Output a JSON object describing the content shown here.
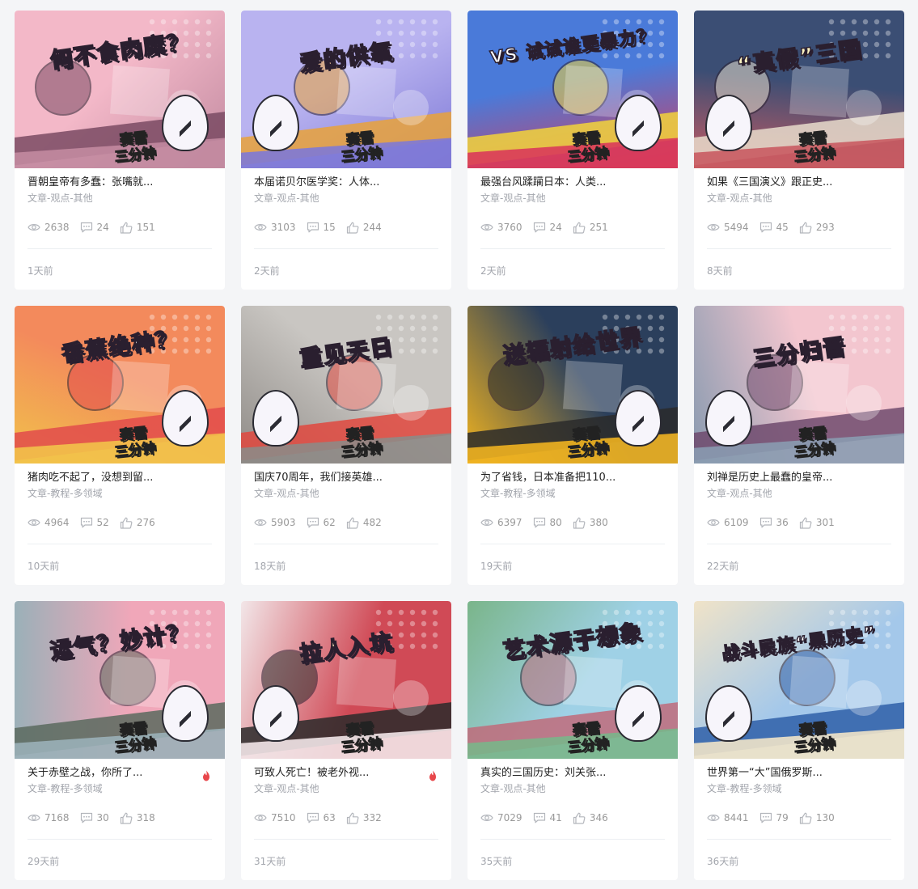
{
  "articles": [
    {
      "thumb_headline": "何不食肉糜？",
      "thumb_stamp": "赛雷\n三分钟",
      "title": "晋朝皇帝有多蠢：张嘴就...",
      "tags": "文章-观点-其他",
      "views": "2638",
      "comments": "24",
      "likes": "151",
      "time": "1天前",
      "hot": false,
      "colors": [
        "#f3b8c8",
        "#c28aa0",
        "#7a4a63"
      ]
    },
    {
      "thumb_headline": "爱的供氧",
      "thumb_stamp": "赛雷\n三分钟",
      "title": "本届诺贝尔医学奖：人体...",
      "tags": "文章-观点-其他",
      "views": "3103",
      "comments": "15",
      "likes": "244",
      "time": "2天前",
      "hot": false,
      "colors": [
        "#b9b3f0",
        "#7e79d6",
        "#e9a23a"
      ]
    },
    {
      "thumb_headline": "VS 试试谁更暴力？",
      "thumb_stamp": "赛雷\n三分钟",
      "title": "最强台风蹂躏日本：人类...",
      "tags": "文章-观点-其他",
      "views": "3760",
      "comments": "24",
      "likes": "251",
      "time": "2天前",
      "hot": false,
      "colors": [
        "#4a7ad9",
        "#d93a5a",
        "#f2d43b"
      ]
    },
    {
      "thumb_headline": "“真假”三国",
      "thumb_stamp": "赛雷\n三分钟",
      "title": "如果《三国演义》跟正史...",
      "tags": "文章-观点-其他",
      "views": "5494",
      "comments": "45",
      "likes": "293",
      "time": "8天前",
      "hot": false,
      "colors": [
        "#3b4e74",
        "#c95b62",
        "#e8dccb"
      ]
    },
    {
      "thumb_headline": "香蕉绝种？",
      "thumb_stamp": "赛雷\n三分钟",
      "title": "猪肉吃不起了，没想到留...",
      "tags": "文章-教程-多领域",
      "views": "4964",
      "comments": "52",
      "likes": "276",
      "time": "10天前",
      "hot": false,
      "colors": [
        "#f38a5c",
        "#f2c24a",
        "#e24b4b"
      ]
    },
    {
      "thumb_headline": "重见天日",
      "thumb_stamp": "赛雷\n三分钟",
      "title": "国庆70周年，我们接英雄...",
      "tags": "文章-观点-其他",
      "views": "5903",
      "comments": "62",
      "likes": "482",
      "time": "18天前",
      "hot": false,
      "colors": [
        "#c9c6c2",
        "#8e8a86",
        "#e0483e"
      ]
    },
    {
      "thumb_headline": "送辐射给世界",
      "thumb_stamp": "赛雷\n三分钟",
      "title": "为了省钱，日本准备把110...",
      "tags": "文章-教程-多领域",
      "views": "6397",
      "comments": "80",
      "likes": "380",
      "time": "19天前",
      "hot": false,
      "colors": [
        "#2b3f5c",
        "#f0b320",
        "#2a2a2a"
      ]
    },
    {
      "thumb_headline": "三分归晋",
      "thumb_stamp": "赛雷\n三分钟",
      "title": "刘禅是历史上最蠢的皇帝...",
      "tags": "文章-观点-其他",
      "views": "6109",
      "comments": "36",
      "likes": "301",
      "time": "22天前",
      "hot": false,
      "colors": [
        "#f3c6cf",
        "#8a9bb0",
        "#6f4a6d"
      ]
    },
    {
      "thumb_headline": "运气？妙计？",
      "thumb_stamp": "赛雷\n三分钟",
      "title": "关于赤壁之战，你所了...",
      "tags": "文章-教程-多领域",
      "views": "7168",
      "comments": "30",
      "likes": "318",
      "time": "29天前",
      "hot": true,
      "colors": [
        "#f0a7b9",
        "#9ab0b8",
        "#5b6a5e"
      ]
    },
    {
      "thumb_headline": "拉人入坑",
      "thumb_stamp": "赛雷\n三分钟",
      "title": "可致人死亡！被老外视...",
      "tags": "文章-观点-其他",
      "views": "7510",
      "comments": "63",
      "likes": "332",
      "time": "31天前",
      "hot": true,
      "colors": [
        "#d04a56",
        "#f2e6e8",
        "#2a2a2a"
      ]
    },
    {
      "thumb_headline": "艺术源于想象",
      "thumb_stamp": "赛雷\n三分钟",
      "title": "真实的三国历史：刘关张...",
      "tags": "文章-观点-其他",
      "views": "7029",
      "comments": "41",
      "likes": "346",
      "time": "35天前",
      "hot": false,
      "colors": [
        "#9fd1e6",
        "#7ab58a",
        "#c06b7a"
      ]
    },
    {
      "thumb_headline": "战斗民族“黑历史”",
      "thumb_stamp": "赛雷\n三分钟",
      "title": "世界第一“大”国俄罗斯...",
      "tags": "文章-教程-多领域",
      "views": "8441",
      "comments": "79",
      "likes": "130",
      "time": "36天前",
      "hot": false,
      "colors": [
        "#a4c8ea",
        "#f0e3c8",
        "#2f5fa8"
      ]
    }
  ],
  "icons": {
    "views": "eye-icon",
    "comments": "comment-icon",
    "likes": "thumbs-up-icon",
    "hot": "flame-icon"
  }
}
